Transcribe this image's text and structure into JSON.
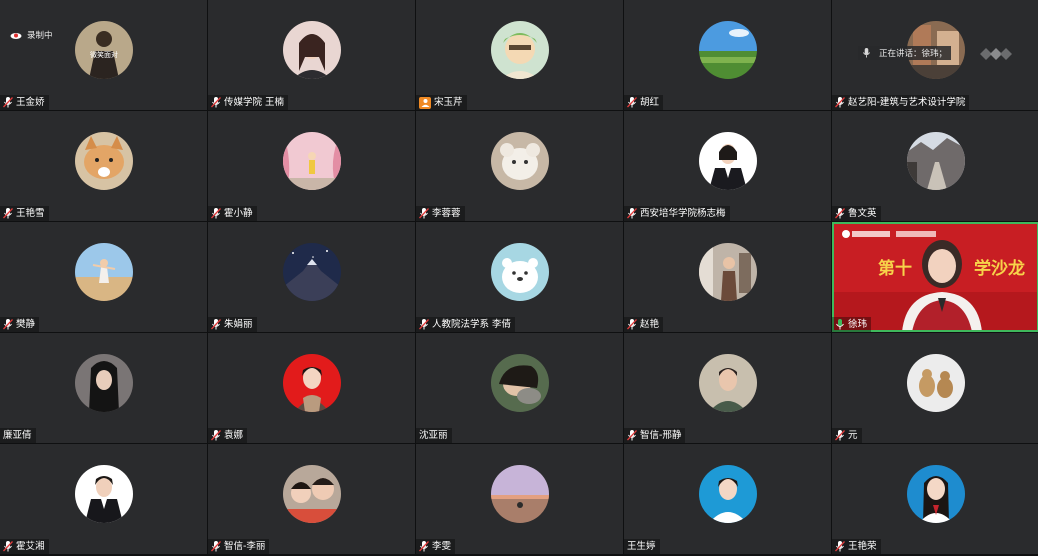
{
  "recording": {
    "label": "录制中"
  },
  "speaking": {
    "label": "正在讲话：徐玮；"
  },
  "tiles": [
    {
      "name": "王金娇",
      "photo_text": "微笑面对"
    },
    {
      "name": "传媒学院 王楠"
    },
    {
      "name": "宋玉芹"
    },
    {
      "name": "胡红"
    },
    {
      "name": "赵艺阳-建筑与艺术设计学院"
    },
    {
      "name": "王艳雪"
    },
    {
      "name": "霍小静"
    },
    {
      "name": "李蓉蓉"
    },
    {
      "name": "西安培华学院杨志梅"
    },
    {
      "name": "鲁文英"
    },
    {
      "name": "樊静"
    },
    {
      "name": "朱娟丽"
    },
    {
      "name": "人教院法学系 李倩"
    },
    {
      "name": "赵艳"
    },
    {
      "name": "徐玮",
      "banner": "第十届……学沙龙",
      "banner_left": "第十",
      "banner_right": "学沙龙"
    },
    {
      "name": "廉亚倩"
    },
    {
      "name": "袁娜"
    },
    {
      "name": "沈亚丽"
    },
    {
      "name": "智信-邢静"
    },
    {
      "name": "元"
    },
    {
      "name": "霍艾湘"
    },
    {
      "name": "智信-李丽"
    },
    {
      "name": "李雯"
    },
    {
      "name": "王生婷"
    },
    {
      "name": "王艳荣"
    }
  ],
  "colors": {
    "tile_bg": "#2a2b2d",
    "active_border": "#3fb85c",
    "host_badge": "#f08a24",
    "banner_red": "#c81e23"
  }
}
